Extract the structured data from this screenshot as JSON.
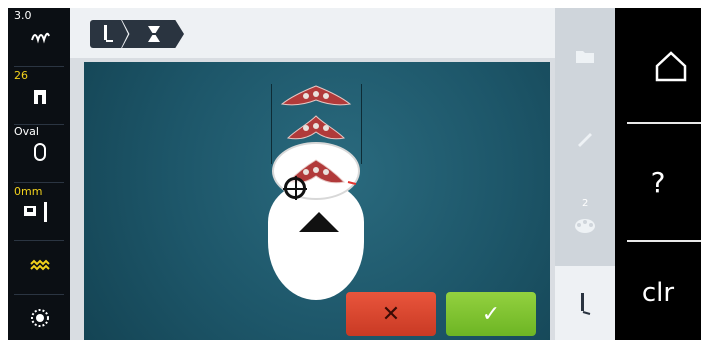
{
  "left_status": {
    "stitch_length": "3.0",
    "stitch_icon": "stitch-pattern-icon",
    "presser_foot": "26",
    "presser_foot_icon": "presser-foot-icon",
    "hoop": "Oval",
    "hoop_icon": "oval-hoop-icon",
    "needle_position": "0mm",
    "needle_icon": "needle-icon",
    "stitch_plate_icon": "stitch-plate-icon",
    "bobbin_icon": "bobbin-icon"
  },
  "breadcrumb": {
    "step1_icon": "needle-stitch-icon",
    "step2_icon": "hourglass-icon"
  },
  "actions": {
    "cancel_label": "✕",
    "confirm_label": "✓"
  },
  "tools": {
    "folder_icon": "folder-icon",
    "pen_icon": "pen-icon",
    "color_count": "2",
    "color_icon": "thread-color-icon",
    "needle_tool_icon": "needle-stitch-icon"
  },
  "nav": {
    "home_icon": "home-icon",
    "help_label": "?",
    "clear_label": "clr"
  },
  "colors": {
    "canvas": "#1d5669",
    "cancel": "#d9472f",
    "confirm": "#7fc22f",
    "accent_yellow": "#f2d11c"
  }
}
